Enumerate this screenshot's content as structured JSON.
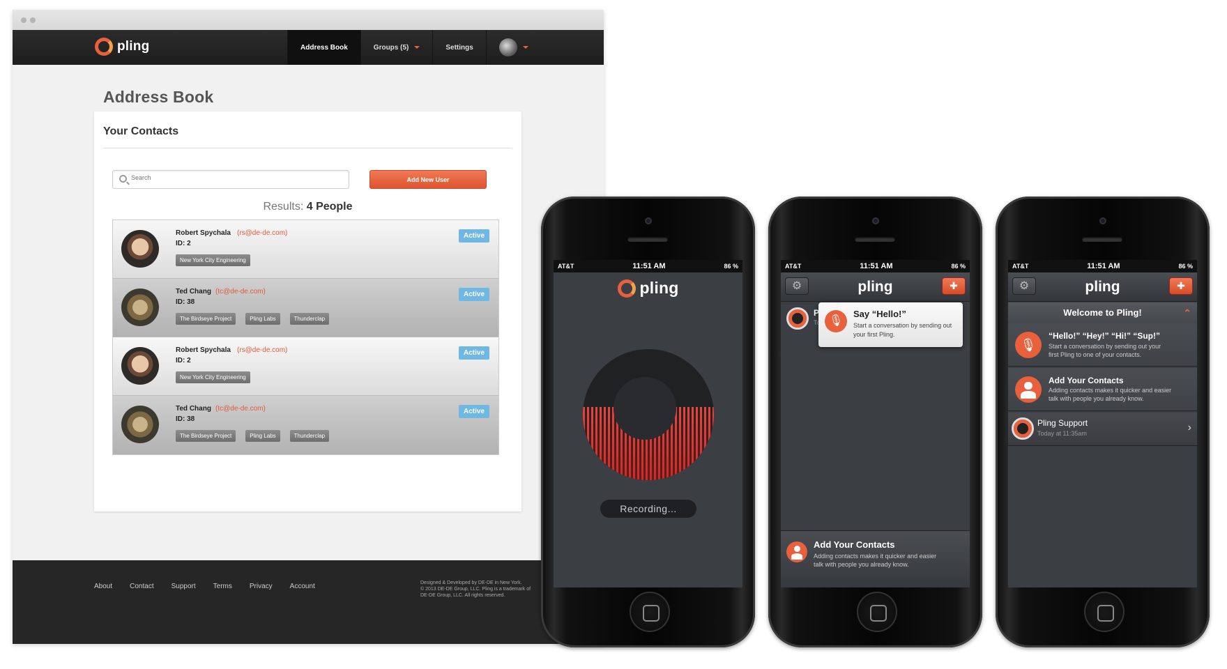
{
  "web": {
    "brand": "pling",
    "nav": [
      {
        "label": "Address Book",
        "active": true
      },
      {
        "label": "Groups (5)",
        "active": false,
        "dropdown": true
      },
      {
        "label": "Settings",
        "active": false
      }
    ],
    "page_title": "Address Book",
    "card_title": "Your Contacts",
    "search_placeholder": "Search",
    "add_button": "Add New User",
    "results_label": "Results:",
    "results_value": "4 People",
    "contacts": [
      {
        "name": "Robert Spychala",
        "email": "(rs@de-de.com)",
        "id": "ID: 2",
        "status": "Active",
        "tags": [
          "New York City Engineering"
        ]
      },
      {
        "name": "Ted Chang",
        "email": "(tc@de-de.com)",
        "id": "ID: 38",
        "status": "Active",
        "tags": [
          "The Birdseye Project",
          "Pling Labs",
          "Thunderclap"
        ]
      },
      {
        "name": "Robert Spychala",
        "email": "(rs@de-de.com)",
        "id": "ID: 2",
        "status": "Active",
        "tags": [
          "New York City Engineering"
        ]
      },
      {
        "name": "Ted Chang",
        "email": "(tc@de-de.com)",
        "id": "ID: 38",
        "status": "Active",
        "tags": [
          "The Birdseye Project",
          "Pling Labs",
          "Thunderclap"
        ]
      }
    ],
    "footer_links": [
      "About",
      "Contact",
      "Support",
      "Terms",
      "Privacy",
      "Account"
    ],
    "footer_note_1": "Designed & Developed by DE-DE in New York.",
    "footer_note_2": "© 2013 DE-DE Group, LLC. Pling is a trademark of",
    "footer_note_3": "DE-DE Group, LLC. All rights reserved."
  },
  "phones": {
    "carrier": "AT&T",
    "time": "11:51 AM",
    "battery": "86 %",
    "app_title": "pling",
    "phone1": {
      "recording_label": "Recording..."
    },
    "phone2": {
      "row_letter": "P",
      "row_sub": "To",
      "popover_title": "Say “Hello!”",
      "popover_desc": "Start a conversation by sending out your first Pling.",
      "bottom_title": "Add Your Contacts",
      "bottom_desc": "Adding contacts makes it quicker and easier talk with people you already know."
    },
    "phone3": {
      "welcome": "Welcome to Pling!",
      "item1_title": "“Hello!” “Hey!” “Hi!” “Sup!”",
      "item1_desc": "Start a conversation by sending out your first Pling to one of your contacts.",
      "item2_title": "Add Your Contacts",
      "item2_desc": "Adding contacts makes it quicker and easier talk with people you already know.",
      "support_name": "Pling Support",
      "support_time": "Today at 11:35am"
    }
  },
  "colors": {
    "accent": "#e8603c",
    "badge": "#6fb8e4",
    "nav_bg": "#1d1d1d"
  }
}
